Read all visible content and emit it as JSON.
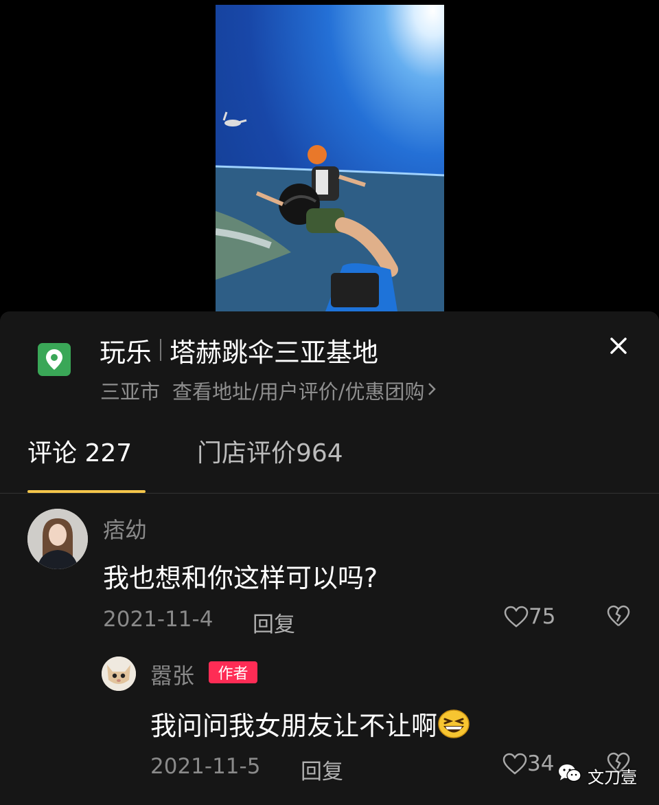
{
  "video": {
    "description_icon": "skydiving-video"
  },
  "poi": {
    "icon": "location-pin-icon",
    "category": "玩乐",
    "name": "塔赫跳伞三亚基地",
    "city": "三亚市",
    "links": "查看地址/用户评价/优惠团购",
    "accent_color": "#3aa757"
  },
  "tabs": [
    {
      "label": "评论 227",
      "active": true
    },
    {
      "label": "门店评价964",
      "active": false
    }
  ],
  "tab_accent_color": "#f5c64a",
  "comments": [
    {
      "username": "痞幼",
      "text": "我也想和你这样可以吗?",
      "date": "2021-11-4",
      "reply_label": "回复",
      "likes": "75",
      "replies": [
        {
          "username": "嚣张",
          "badge": "作者",
          "text": "我问问我女朋友让不让啊",
          "emoji": "laughing-emoji",
          "date": "2021-11-5",
          "reply_label": "回复",
          "likes": "34"
        }
      ]
    }
  ],
  "badge_color": "#fe2c55",
  "watermark": {
    "text": "文刀壹",
    "icon": "wechat-icon"
  }
}
